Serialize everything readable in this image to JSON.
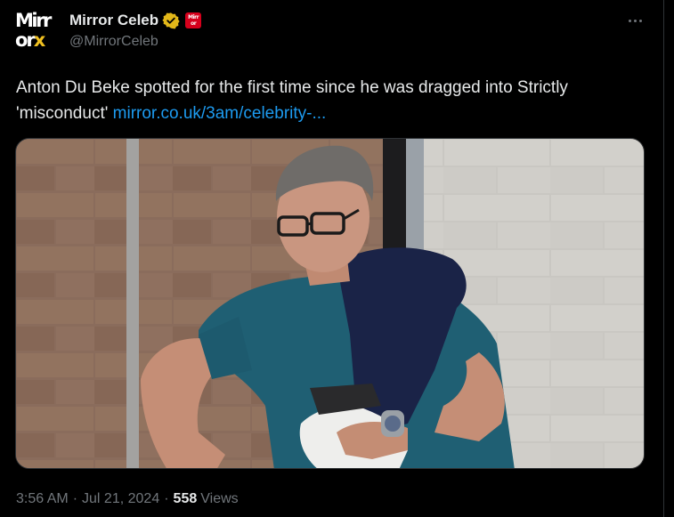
{
  "account": {
    "display_name": "Mirror Celeb",
    "handle": "@MirrorCeleb",
    "avatar_logo_top": "Mirr",
    "avatar_logo_bottom_or": "or",
    "avatar_logo_bottom_x": "x",
    "verified_icon": "gold-verified-badge-icon",
    "affiliate_badge_top": "Mirr",
    "affiliate_badge_bottom": "or"
  },
  "tweet": {
    "text": "Anton Du Beke spotted for the first time since he was dragged into Strictly 'misconduct' ",
    "link_text": "mirror.co.uk/3am/celebrity-...",
    "more_icon": "more-options-icon"
  },
  "media": {
    "description": "Man in glasses and teal t-shirt with navy jumper over shoulders, by a brick wall"
  },
  "meta": {
    "time": "3:56 AM",
    "separator": "·",
    "date": "Jul 21, 2024",
    "views_count": "558",
    "views_label": "Views"
  },
  "colors": {
    "background": "#000000",
    "text": "#e7e9ea",
    "secondary_text": "#71767b",
    "link": "#1d9bf0",
    "verified_gold": "#e2b719",
    "mirror_red": "#d6001c"
  }
}
